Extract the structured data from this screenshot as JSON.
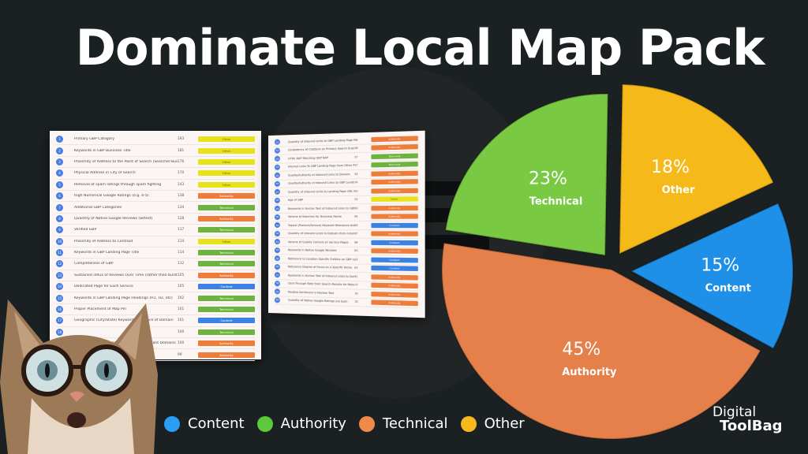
{
  "title": "Dominate Local Map Pack",
  "tag_colors": {
    "Other": "#e8e21a",
    "Authority": "#ee7d3b",
    "Technical": "#6cb33f",
    "Content": "#3b82e6"
  },
  "table_left": {
    "rows": [
      {
        "n": "1",
        "factor": "Primary GBP Category",
        "score": "193",
        "tag": "Other"
      },
      {
        "n": "2",
        "factor": "Keywords in GBP Business Title",
        "score": "181",
        "tag": "Other"
      },
      {
        "n": "3",
        "factor": "Proximity of Address to the Point of Search (Searcher-Business Distance)",
        "score": "176",
        "tag": "Other"
      },
      {
        "n": "4",
        "factor": "Physical Address in City of Search",
        "score": "170",
        "tag": "Other"
      },
      {
        "n": "5",
        "factor": "Removal of spam listings through spam fighting",
        "score": "143",
        "tag": "Other"
      },
      {
        "n": "6",
        "factor": "High Numerical Google Ratings (e.g. 4-5)",
        "score": "138",
        "tag": "Authority"
      },
      {
        "n": "7",
        "factor": "Additional GBP Categories",
        "score": "134",
        "tag": "Technical"
      },
      {
        "n": "8",
        "factor": "Quantity of Native Google Reviews (w/text)",
        "score": "128",
        "tag": "Authority"
      },
      {
        "n": "9",
        "factor": "Verified GBP",
        "score": "117",
        "tag": "Technical"
      },
      {
        "n": "10",
        "factor": "Proximity of Address to Centroid",
        "score": "114",
        "tag": "Other"
      },
      {
        "n": "11",
        "factor": "Keywords in GBP Landing Page Title",
        "score": "114",
        "tag": "Technical"
      },
      {
        "n": "12",
        "factor": "Completeness of GBP",
        "score": "112",
        "tag": "Technical"
      },
      {
        "n": "13",
        "factor": "Sustained influx of Reviews Over Time (rather than bursts)",
        "score": "105",
        "tag": "Authority"
      },
      {
        "n": "14",
        "factor": "Dedicated Page for Each Service",
        "score": "105",
        "tag": "Content"
      },
      {
        "n": "15",
        "factor": "Keywords in GBP Landing Page Headings (H1, H2, etc)",
        "score": "102",
        "tag": "Technical"
      },
      {
        "n": "16",
        "factor": "Proper Placement of Map Pin",
        "score": "101",
        "tag": "Technical"
      },
      {
        "n": "17",
        "factor": "Geographic (City/State) Keyword Relevance of Domain",
        "score": "101",
        "tag": "Content"
      },
      {
        "n": "18",
        "factor": "",
        "score": "100",
        "tag": "Technical"
      },
      {
        "n": "19",
        "factor": "Quality of Inbound Links from Locally-Relevant Domains",
        "score": "100",
        "tag": "Authority"
      },
      {
        "n": "20",
        "factor": "",
        "score": "99",
        "tag": "Authority"
      }
    ]
  },
  "table_right": {
    "rows": [
      {
        "n": "21",
        "factor": "Quantity of Inbound Links to GBP Landing Page URL from Locally-Relevant Domains",
        "score": "98",
        "tag": "Authority"
      },
      {
        "n": "22",
        "factor": "Consistency of Citations on Primary Search Engines (Google Maps, Bing Maps, Apple Maps)",
        "score": "98",
        "tag": "Authority"
      },
      {
        "n": "23",
        "factor": "HTML NAP Matching GBP NAP",
        "score": "97",
        "tag": "Technical"
      },
      {
        "n": "24",
        "factor": "Internal Links To GBP Landing Page from Other Pages of Website",
        "score": "97",
        "tag": "Technical"
      },
      {
        "n": "25",
        "factor": "Quality/Authority of Inbound Links to Domain",
        "score": "94",
        "tag": "Authority"
      },
      {
        "n": "26",
        "factor": "Quality/Authority of Inbound Links to GBP Landing Page URL",
        "score": "94",
        "tag": "Authority"
      },
      {
        "n": "27",
        "factor": "Quantity of Inbound Links to Landing Page URL from Industry-Relevant Domains",
        "score": "93",
        "tag": "Authority"
      },
      {
        "n": "28",
        "factor": "Age of GBP",
        "score": "93",
        "tag": "Other"
      },
      {
        "n": "29",
        "factor": "Keywords in Anchor Text of Inbound Links to GBP Landing Page URL",
        "score": "90",
        "tag": "Authority"
      },
      {
        "n": "30",
        "factor": "Volume of Searches for Business Name",
        "score": "89",
        "tag": "Authority"
      },
      {
        "n": "31",
        "factor": "Topical (Product/Service) Keyword Relevance Across Entire Website",
        "score": "89",
        "tag": "Content"
      },
      {
        "n": "32",
        "factor": "Quantity of Inbound Links to Domain from Industry-Relevant Domains",
        "score": "87",
        "tag": "Authority"
      },
      {
        "n": "33",
        "factor": "Volume of Quality Content on Service Pages",
        "score": "86",
        "tag": "Content"
      },
      {
        "n": "34",
        "factor": "Keywords in Native Google Reviews",
        "score": "83",
        "tag": "Authority"
      },
      {
        "n": "35",
        "factor": "Reference to Location-Specific Entities on GBP Landing Page",
        "score": "83",
        "tag": "Content"
      },
      {
        "n": "36",
        "factor": "Reference Degree of Focus on a Specific Niche",
        "score": "83",
        "tag": "Content"
      },
      {
        "n": "37",
        "factor": "Keywords in Anchor Text of Inbound Links to Domain",
        "score": "81",
        "tag": "Authority"
      },
      {
        "n": "38",
        "factor": "Click-Through Rate from Search Results for Relevant Search Terms from Geographically Relevant Locations",
        "score": "79",
        "tag": "Authority"
      },
      {
        "n": "39",
        "factor": "Positive Sentiment in Review Text",
        "score": "78",
        "tag": "Authority"
      },
      {
        "n": "40",
        "factor": "Quantity of Native Google Ratings (no text)",
        "score": "78",
        "tag": "Authority"
      }
    ]
  },
  "chart_data": {
    "type": "pie",
    "title": "Dominate Local Map Pack",
    "slices": [
      {
        "label": "Technical",
        "value": 23,
        "display": "23%",
        "color": "#7ac943"
      },
      {
        "label": "Other",
        "value": 18,
        "display": "18%",
        "color": "#f6b91a"
      },
      {
        "label": "Content",
        "value": 15,
        "display": "15%",
        "color": "#1e90e8"
      },
      {
        "label": "Authority",
        "value": 45,
        "display": "45%",
        "color": "#e5804a"
      }
    ],
    "legend": {
      "placement": "bottom",
      "items": [
        {
          "label": "Content",
          "color": "#2a9df4"
        },
        {
          "label": "Authority",
          "color": "#5cc83a"
        },
        {
          "label": "Technical",
          "color": "#f08a4b"
        },
        {
          "label": "Other",
          "color": "#f8b91c"
        }
      ]
    }
  },
  "brand": {
    "line1": "Digital",
    "line2": "ToolBag"
  }
}
